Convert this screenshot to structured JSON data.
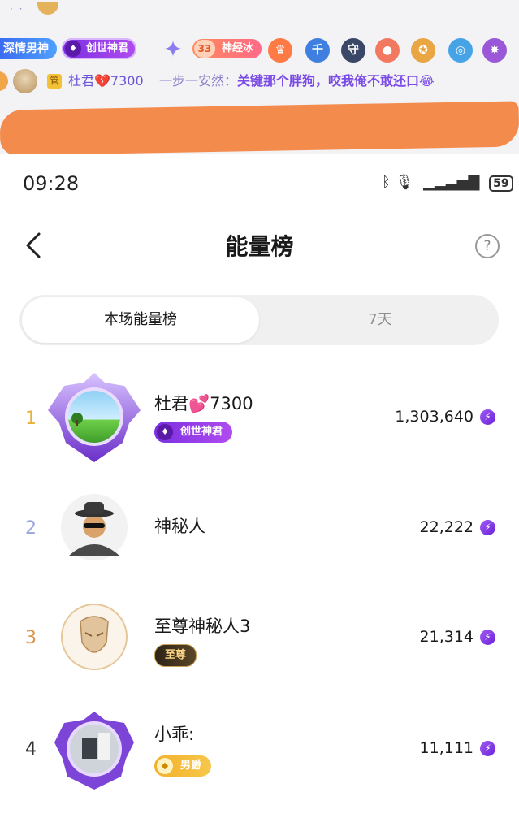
{
  "stream": {
    "tags": {
      "blue": "深情男神",
      "purple": "创世神君",
      "level_num": "33",
      "orange": "神经冰"
    },
    "chat": {
      "guan": "管",
      "name": "杜君💔7300",
      "sender": "一步一安然：",
      "message": "关键那个胖狗，咬我俺不敢还口😂"
    }
  },
  "status_bar": {
    "time": "09:28",
    "battery": "59"
  },
  "nav": {
    "title": "能量榜"
  },
  "tabs": [
    {
      "label": "本场能量榜",
      "active": true
    },
    {
      "label": "7天",
      "active": false
    }
  ],
  "ranking": [
    {
      "rank": "1",
      "name": "杜君💕7300",
      "score": "1,303,640",
      "badge": "创世神君",
      "rank_color": "#e8b13a"
    },
    {
      "rank": "2",
      "name": "神秘人",
      "score": "22,222",
      "badge": "",
      "rank_color": "#9aa4e0"
    },
    {
      "rank": "3",
      "name": "至尊神秘人3",
      "score": "21,314",
      "badge": "至尊",
      "rank_color": "#d9954a"
    },
    {
      "rank": "4",
      "name": "小乖:",
      "score": "11,111",
      "badge": "男爵",
      "rank_color": "#333333"
    }
  ]
}
